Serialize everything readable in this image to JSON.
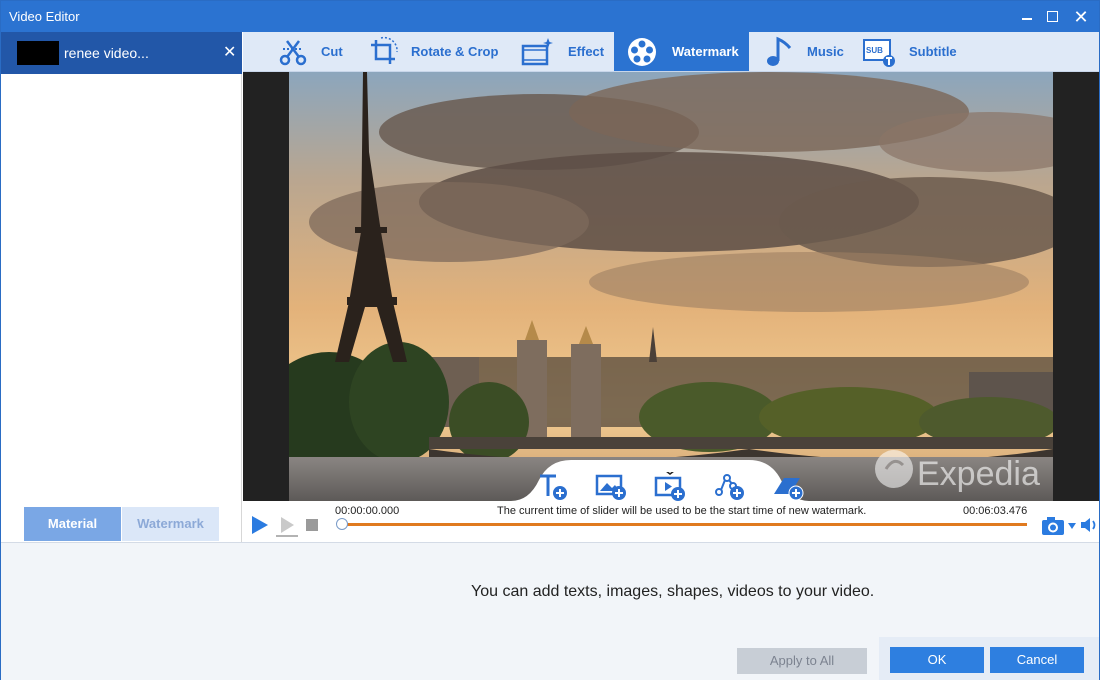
{
  "window": {
    "title": "Video Editor",
    "minimize": "minimize",
    "maximize": "maximize",
    "close": "✕"
  },
  "file_tab": {
    "name": "renee video...",
    "close": "✕"
  },
  "left_tabs": {
    "material": "Material",
    "watermark": "Watermark"
  },
  "toolbar": {
    "cut": "Cut",
    "rotate_crop": "Rotate & Crop",
    "effect": "Effect",
    "watermark": "Watermark",
    "music": "Music",
    "subtitle": "Subtitle",
    "active": "watermark"
  },
  "preview": {
    "watermark_text": "Expedia",
    "add_tools": [
      "add-text",
      "add-image",
      "add-video",
      "add-shape",
      "add-clear"
    ]
  },
  "playback": {
    "time_start": "00:00:00.000",
    "time_end": "00:06:03.476",
    "hint": "The current time of slider will be used to be the start time of new watermark.",
    "progress": 0.0
  },
  "bottom": {
    "message": "You can add texts, images, shapes, videos to your video.",
    "apply_all": "Apply to All",
    "ok": "OK",
    "cancel": "Cancel"
  },
  "colors": {
    "accent": "#2b73d1",
    "track": "#e07a1f",
    "button": "#2e7fe0"
  }
}
